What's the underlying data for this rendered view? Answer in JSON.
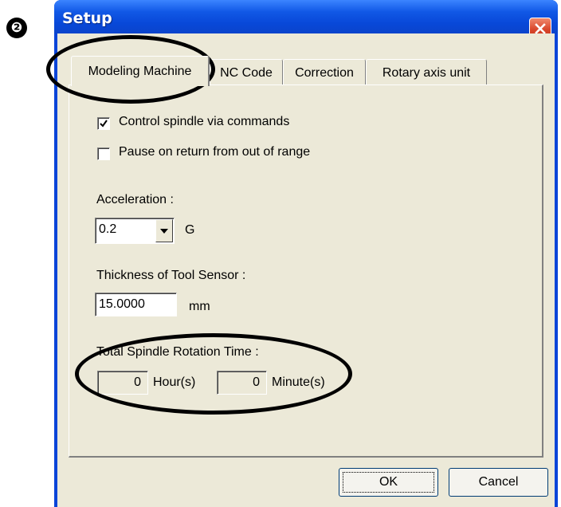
{
  "step_badge": "❷",
  "window": {
    "title": "Setup"
  },
  "icons": {
    "close": "close-icon",
    "dropdown": "chevron-down-icon",
    "check": "checkmark-icon"
  },
  "colors": {
    "titlebar": "#0848d8",
    "close_button": "#d8452a",
    "dialog_bg": "#ece9d8"
  },
  "tabs": [
    {
      "label": "Modeling Machine",
      "active": true
    },
    {
      "label": "NC Code",
      "active": false
    },
    {
      "label": "Correction",
      "active": false
    },
    {
      "label": "Rotary axis unit",
      "active": false
    }
  ],
  "options": {
    "control_spindle": {
      "label": "Control spindle via commands",
      "checked": true
    },
    "pause_on_return": {
      "label": "Pause on return from out of range",
      "checked": false
    }
  },
  "acceleration": {
    "label": "Acceleration :",
    "value": "0.2",
    "unit": "G"
  },
  "tool_sensor": {
    "label": "Thickness of Tool Sensor :",
    "value": "15.0000",
    "unit": "mm"
  },
  "spindle_time": {
    "label": "Total Spindle Rotation Time :",
    "hours_value": "0",
    "hours_unit": "Hour(s)",
    "minutes_value": "0",
    "minutes_unit": "Minute(s)"
  },
  "buttons": {
    "ok": "OK",
    "cancel": "Cancel"
  }
}
